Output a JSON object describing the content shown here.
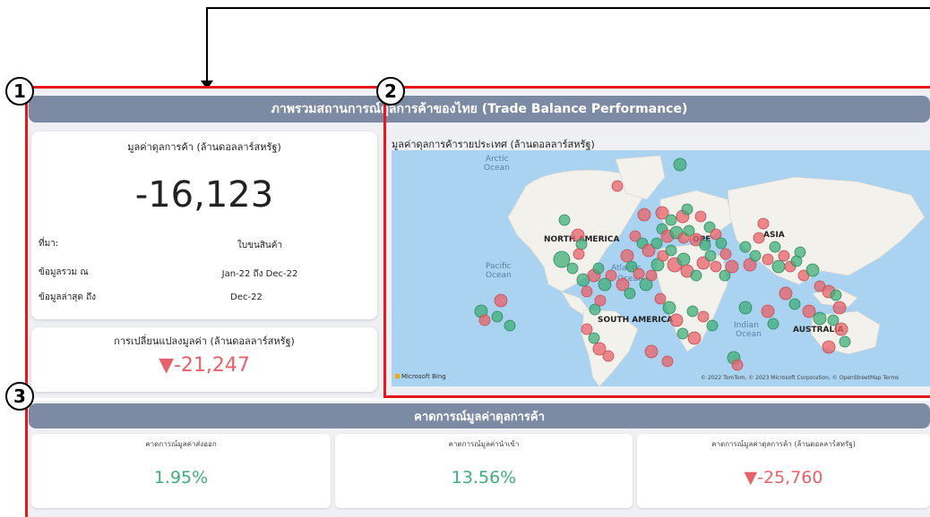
{
  "annotations": {
    "badges": [
      "1",
      "2",
      "3"
    ]
  },
  "overview": {
    "header": "ภาพรวมสถานการณ์ดุลการค้าของไทย (Trade Balance Performance)",
    "balance_card": {
      "title": "มูลค่าดุลการค้า (ล้านดอลลาร์สหรัฐ)",
      "value": "-16,123",
      "rows": [
        {
          "label": "ที่มา:",
          "value": "ใบขนสินค้า"
        },
        {
          "label": "ข้อมูลรวม ณ",
          "value": "Jan-22 ถึง Dec-22"
        },
        {
          "label": "ข้อมูลล่าสุด ถึง",
          "value": "Dec-22"
        }
      ]
    },
    "change_card": {
      "title": "การเปลี่ยนแปลงมูลค่า (ล้านดอลลาร์สหรัฐ)",
      "value": "▼-21,247"
    }
  },
  "map": {
    "title": "มูลค่าดุลการค้ารายประเทศ (ล้านดอลลาร์สหรัฐ)",
    "continent_labels": [
      "NORTH AMERICA",
      "OPE",
      "ASIA",
      "SOUTH AMERICA",
      "AUSTRALIA"
    ],
    "ocean_labels": [
      "Arctic",
      "Ocean",
      "Pacific",
      "Ocean",
      "Atlantic",
      "Ocean",
      "Indian",
      "Ocean"
    ],
    "bing_logo": "Microsoft Bing",
    "copyright": "© 2022 TomTom, © 2023 Microsoft Corporation, © OpenStreetMap  Terms",
    "colors": {
      "surplus": "#3fae7a",
      "deficit": "#e8616a"
    }
  },
  "forecast": {
    "header": "คาดการณ์มูลค่าดุลการค้า",
    "cards": [
      {
        "title": "คาดการณ์มูลค่าส่งออก",
        "value": "1.95%"
      },
      {
        "title": "คาดการณ์มูลค่านำเข้า",
        "value": "13.56%"
      },
      {
        "title": "คาดการณ์มูลค่าดุลการค้า (ล้านดอลลาร์สหรัฐ)",
        "value": "▼-25,760"
      }
    ]
  }
}
